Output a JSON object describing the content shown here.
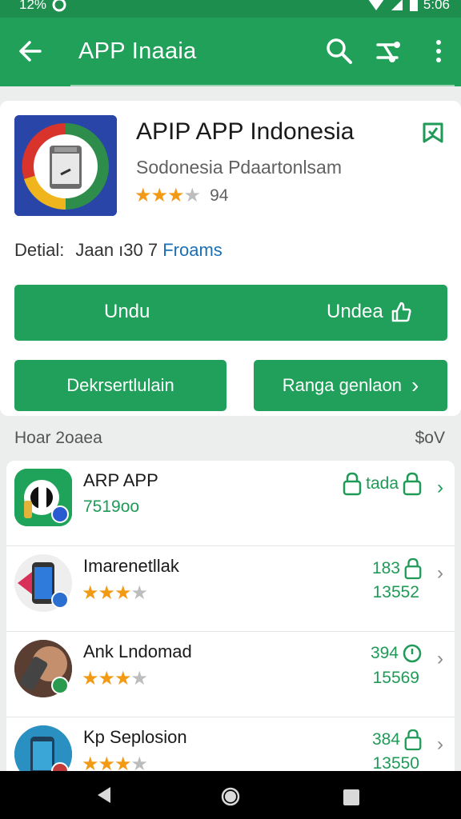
{
  "status_bar": {
    "left_text": "12%",
    "time": "5:06"
  },
  "app_bar": {
    "title": "APP Inaaia"
  },
  "app": {
    "name": "APIP  APP Indonesia",
    "publisher": "Sodonesia Pdaartonlsam",
    "stars_filled": "★★★",
    "stars_half": "★",
    "rating_count": "94",
    "detail_label": "Detial:",
    "detail_value": "Jaan ı30 7",
    "detail_link": "Froams"
  },
  "buttons": {
    "primary_left": "Undu",
    "primary_right": "Undea",
    "secondary_left": "Dekrsertlulain",
    "secondary_right": "Ranga genlaon",
    "secondary_right_chevron": "›"
  },
  "section": {
    "title": "Hoar 2oaea",
    "right": "$oV"
  },
  "list": [
    {
      "name": "ARP APP",
      "sub": "7519oo",
      "meta_a": "tada",
      "meta_b": "",
      "stars": "",
      "icon": "lock-icon"
    },
    {
      "name": "Imarenetllak",
      "sub": "",
      "meta_a": "183",
      "meta_b": "13552",
      "stars": "★★★",
      "icon": "lock-icon"
    },
    {
      "name": "Ank Lndomad",
      "sub": "",
      "meta_a": "394",
      "meta_b": "15569",
      "stars": "★★★",
      "icon": "clock-icon"
    },
    {
      "name": "Kp Seplosion",
      "sub": "",
      "meta_a": "384",
      "meta_b": "13550",
      "stars": "★★★",
      "icon": "lock-icon"
    }
  ],
  "colors": {
    "primary": "#21a05a",
    "status_bar": "#1e8e4f",
    "star": "#f29a14",
    "link": "#1a6fb5"
  }
}
